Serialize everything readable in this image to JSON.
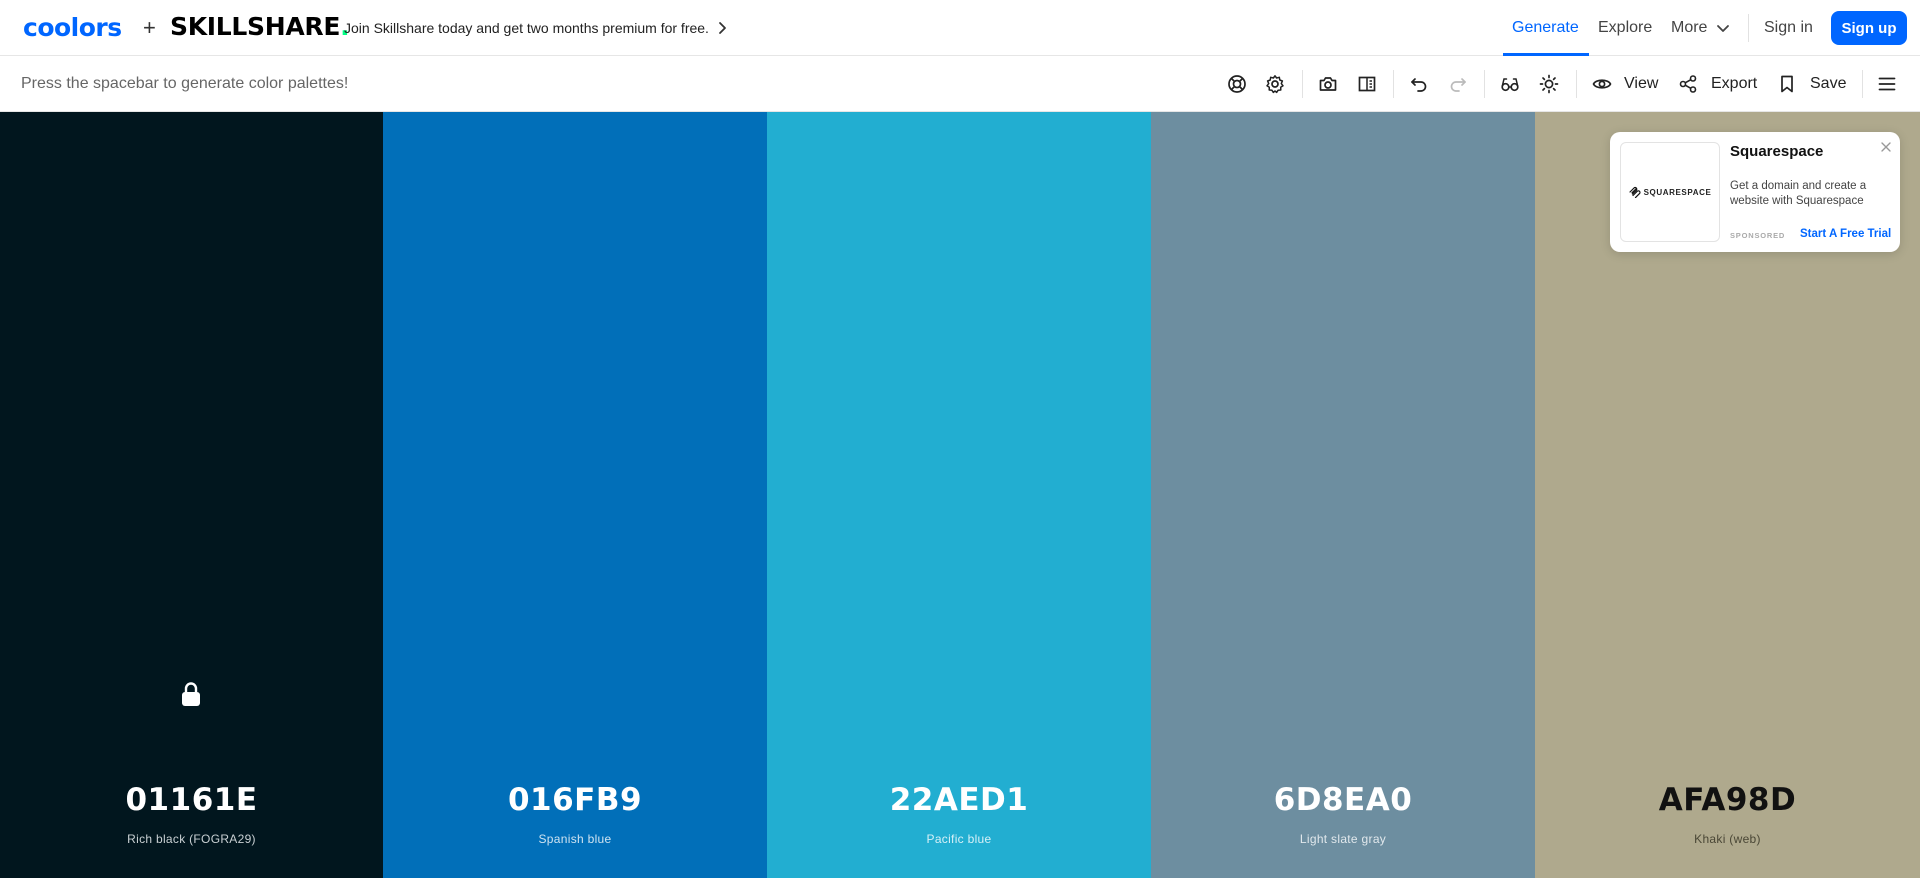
{
  "topbar": {
    "logo_coolors": "coolors",
    "plus": "+",
    "logo_skillshare": "SKILLSHARE",
    "logo_skillshare_dot": ".",
    "promo_text": "Join Skillshare today and get two months premium for free.",
    "nav": {
      "generate": "Generate",
      "explore": "Explore",
      "more": "More",
      "signin": "Sign in",
      "signup": "Sign up"
    },
    "accent": "#0066ff"
  },
  "toolbar": {
    "hint": "Press the spacebar to generate color palettes!",
    "icons": [
      "help-icon",
      "settings-icon",
      "camera-icon",
      "split-view-icon",
      "undo-icon",
      "redo-icon",
      "glasses-icon",
      "sun-icon",
      "eye-icon",
      "share-icon",
      "bookmark-icon",
      "menu-icon"
    ],
    "view_label": "View",
    "export_label": "Export",
    "save_label": "Save"
  },
  "palette": {
    "colors": [
      {
        "hex": "01161E",
        "name": "Rich black (FOGRA29)",
        "bg": "#01161E",
        "text_color": "#ffffff",
        "name_color": "#c9d0d3",
        "locked": true
      },
      {
        "hex": "016FB9",
        "name": "Spanish blue",
        "bg": "#016FB9",
        "text_color": "#ffffff",
        "name_color": "#cfe3f1",
        "locked": false
      },
      {
        "hex": "22AED1",
        "name": "Pacific blue",
        "bg": "#22AED1",
        "text_color": "#ffffff",
        "name_color": "#d6f0f7",
        "locked": false
      },
      {
        "hex": "6D8EA0",
        "name": "Light slate gray",
        "bg": "#6D8EA0",
        "text_color": "#ffffff",
        "name_color": "#e1e8ec",
        "locked": false
      },
      {
        "hex": "AFA98D",
        "name": "Khaki (web)",
        "bg": "#AFA98D",
        "text_color": "#111111",
        "name_color": "#4a4736",
        "locked": false
      }
    ]
  },
  "ad": {
    "brand_logo_text": "SQUARESPACE",
    "title": "Squarespace",
    "body": "Get a domain and create a website with Squarespace",
    "sponsored": "SPONSORED",
    "cta": "Start A Free Trial"
  }
}
